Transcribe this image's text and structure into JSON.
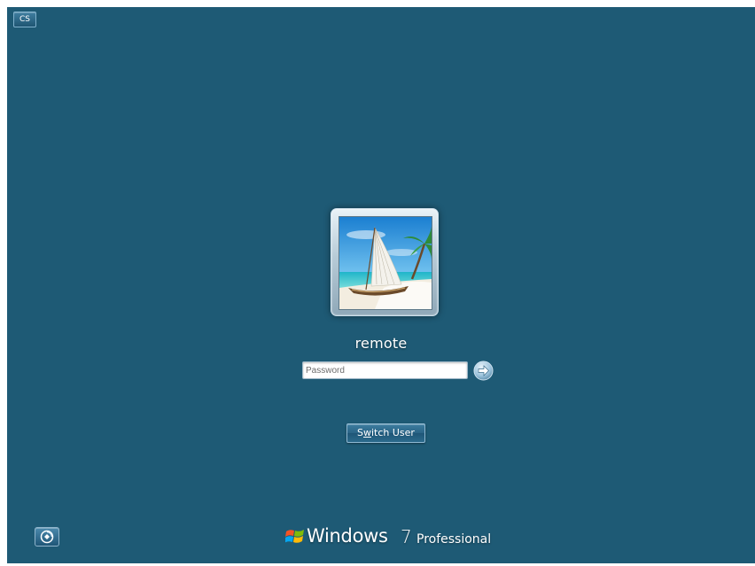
{
  "login": {
    "language_indicator": "CS",
    "user_name": "remote",
    "password": {
      "placeholder": "Password",
      "value": ""
    },
    "submit_icon": "arrow-right-icon",
    "switch_user_label_pre": "S",
    "switch_user_label_access": "w",
    "switch_user_label_post": "itch User",
    "ease_of_access_icon": "ease-of-access-icon",
    "user_picture": "sailboat-beach-image"
  },
  "branding": {
    "name": "Windows",
    "version": "7",
    "edition": "Professional",
    "logo_icon": "windows-flag-icon"
  },
  "colors": {
    "background": "#1e5a75",
    "text": "#ffffff",
    "button_gradient_top": "#3d7da0",
    "button_gradient_bottom": "#1f5677"
  }
}
